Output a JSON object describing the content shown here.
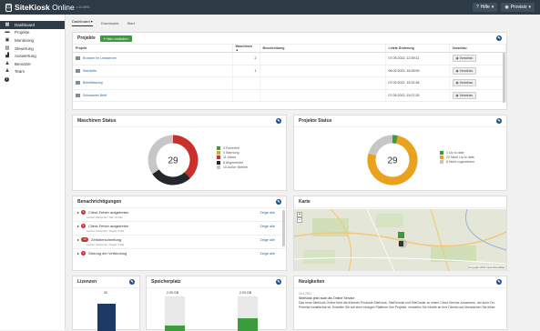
{
  "app": {
    "brand": "SiteKiosk",
    "brand_suffix": "Online",
    "version": "v.14.8891"
  },
  "topbar": {
    "help": "Hilfe",
    "user": "Provisio"
  },
  "sidebar": {
    "items": [
      {
        "label": "Dashboard",
        "icon": "dashboard-icon",
        "active": true
      },
      {
        "label": "Projekte",
        "icon": "folder-icon"
      },
      {
        "label": "Monitoring",
        "icon": "monitor-icon"
      },
      {
        "label": "Steuerung",
        "icon": "control-icon"
      },
      {
        "label": "Auswertung",
        "icon": "chart-icon"
      },
      {
        "label": "Benutzer",
        "icon": "user-icon"
      },
      {
        "label": "Team",
        "icon": "team-icon"
      },
      {
        "label": "",
        "icon": "info-icon"
      }
    ]
  },
  "tabs": [
    "Dashboard ▾",
    "Downloads",
    "Start"
  ],
  "projects": {
    "title": "Projekte",
    "new_button": "Neu erstellen",
    "headers": [
      "Projekt",
      "Maschinen ▲",
      "Beschreibung",
      "Letzte Änderung",
      "Vorschau"
    ],
    "rows": [
      {
        "name": "Browser im Leasserom",
        "machines": "2",
        "desc": "",
        "changed": "07.09.2022, 12:39:11",
        "preview": "Vorschau"
      },
      {
        "name": "Startseite",
        "machines": "1",
        "desc": "",
        "changed": "06.09.2022, 16:28:59",
        "preview": "Vorschau"
      },
      {
        "name": "Beleitfassung",
        "machines": "",
        "desc": "",
        "changed": "07.09.2022, 15:32:46",
        "preview": "Vorschau"
      },
      {
        "name": "Schwarzes Brett",
        "machines": "",
        "desc": "",
        "changed": "07.09.2022, 15:27:25",
        "preview": "Vorschau"
      }
    ]
  },
  "machine_status": {
    "title": "Maschinen Status",
    "center": "29",
    "legend": [
      "0 Fehlerfrei",
      "0 Warnung",
      "11 Alarm",
      "8 Abgemeldet",
      "10 Außer Betrieb"
    ],
    "colors": [
      "#3a9c3a",
      "#e8a21d",
      "#c9302c",
      "#23282c",
      "#c7c7c7"
    ],
    "segments": [
      0,
      0,
      11,
      8,
      10
    ]
  },
  "project_status": {
    "title": "Projekte Status",
    "center": "29",
    "legend": [
      "1 Up to date",
      "22 Nicht Up to date",
      "6 Nicht zugewiesen"
    ],
    "colors": [
      "#3a9c3a",
      "#e8a21d",
      "#c7c7c7"
    ],
    "segments": [
      1,
      22,
      6
    ]
  },
  "notifications": {
    "title": "Benachrichtigungen",
    "items": [
      {
        "badge": "3",
        "title": "Client-Fehler aufgetreten",
        "sub": "Letzter Zeitpunkt / Std. 10 Min",
        "link": "Zeige alle"
      },
      {
        "badge": "2",
        "title": "Client-Fehler aufgetreten",
        "sub": "Letzter Zeitpunkt / Tag(e) 9 Std",
        "link": "Zeige alle"
      },
      {
        "badge": "10",
        "title": "Zeitüberschreitung",
        "sub": "Letzter Zeitpunkt / Tag(e) 9 Std",
        "link": "Zeige alle"
      },
      {
        "badge": "3",
        "title": "Störung der Verbindung",
        "sub": "",
        "link": "Zeige alle"
      }
    ]
  },
  "map": {
    "title": "Karte",
    "zoom_in": "+",
    "zoom_out": "−",
    "attribution": "Copyright 2021 OpenStreetMap"
  },
  "licenses": {
    "title": "Lizenzen",
    "value": "30"
  },
  "storage": {
    "title": "Speicherplatz",
    "values": [
      "2.05 GB",
      "2.93 GB"
    ]
  },
  "news": {
    "title": "Neuigkeiten",
    "date": "16.4.2021",
    "headline": "SiteKiosk jetzt auch als Online Service",
    "text": "Das neue SiteKiosk Online führt die früheren Produkte SiteKiosk, SiteRemote und SiteCaster zu einem Cloud Service zusammen, der auch On-Premise installierbar ist. Erstellen Sie auf einer einzigen Plattform Ihre Projekte, verwalten Sie Inhalte an Ihre Clients und überwachen Sie diese."
  }
}
